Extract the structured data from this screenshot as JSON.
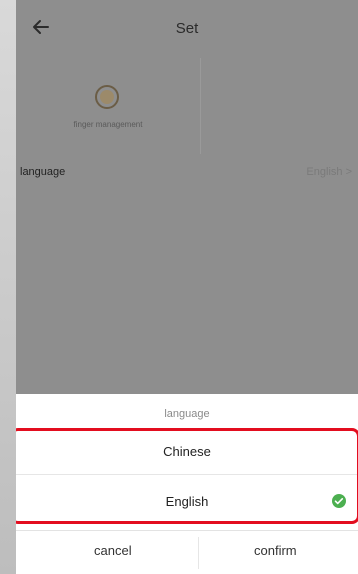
{
  "header": {
    "title": "Set",
    "back_icon": "back-arrow-icon"
  },
  "tiles": [
    {
      "label": "finger management",
      "icon": "fingerprint-icon"
    }
  ],
  "settings": {
    "language_label": "language",
    "language_value": "English",
    "chevron": ">"
  },
  "sheet": {
    "title": "language",
    "options": [
      {
        "label": "Chinese",
        "selected": false
      },
      {
        "label": "English",
        "selected": true,
        "icon": "check-icon"
      }
    ],
    "cancel_label": "cancel",
    "confirm_label": "confirm"
  },
  "colors": {
    "highlight": "#e30d1f",
    "check": "#4caf50"
  }
}
